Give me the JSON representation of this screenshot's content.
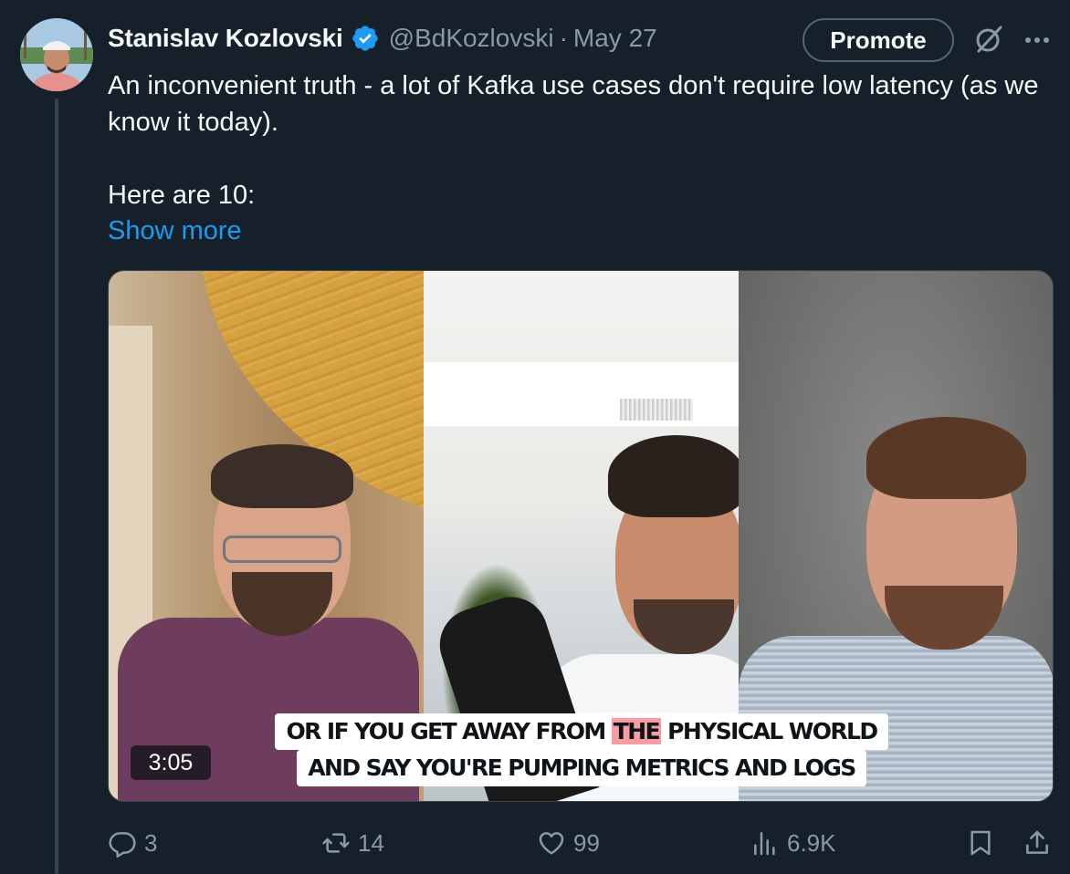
{
  "author": {
    "name": "Stanislav Kozlovski",
    "handle": "@BdKozlovski",
    "separator": "·",
    "date": "May 27",
    "verified": true
  },
  "header": {
    "promote_label": "Promote",
    "grok_icon": "grok-icon",
    "more_icon": "more-horizontal-icon"
  },
  "tweet": {
    "line1": "An inconvenient truth - a lot of Kafka use cases don't require low latency (as we know it today).",
    "line2": "Here are 10:",
    "show_more": "Show more"
  },
  "video": {
    "duration": "3:05",
    "caption_line1_before": "OR IF YOU GET AWAY FROM ",
    "caption_line1_highlight": "THE",
    "caption_line1_after": " PHYSICAL WORLD",
    "caption_line2": "AND SAY YOU'RE PUMPING METRICS AND LOGS"
  },
  "actions": {
    "replies": "3",
    "reposts": "14",
    "likes": "99",
    "views": "6.9K"
  },
  "colors": {
    "background": "#15202b",
    "accent": "#1d9bf0",
    "secondary_text": "#8b98a5",
    "caption_highlight": "#f59da3"
  }
}
